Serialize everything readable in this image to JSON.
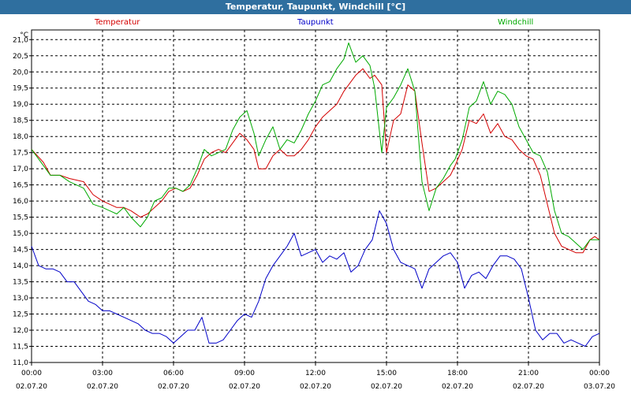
{
  "window": {
    "title": "Temperatur, Taupunkt, Windchill [°C]"
  },
  "chart_data": {
    "type": "line",
    "title": "Temperatur, Taupunkt, Windchill [°C]",
    "ylabel": "°C",
    "xlabel": "",
    "ylim": [
      11.0,
      21.3
    ],
    "xlim": [
      0,
      24
    ],
    "grid": true,
    "legend_placement": "top",
    "y_ticks": [
      "11,0",
      "11,5",
      "12,0",
      "12,5",
      "13,0",
      "13,5",
      "14,0",
      "14,5",
      "15,0",
      "15,5",
      "16,0",
      "16,5",
      "17,0",
      "17,5",
      "18,0",
      "18,5",
      "19,0",
      "19,5",
      "20,0",
      "20,5",
      "21,0"
    ],
    "x_ticks": [
      {
        "time": "00:00",
        "date": "02.07.20"
      },
      {
        "time": "03:00",
        "date": "02.07.20"
      },
      {
        "time": "06:00",
        "date": "02.07.20"
      },
      {
        "time": "09:00",
        "date": "02.07.20"
      },
      {
        "time": "12:00",
        "date": "02.07.20"
      },
      {
        "time": "15:00",
        "date": "02.07.20"
      },
      {
        "time": "18:00",
        "date": "02.07.20"
      },
      {
        "time": "21:00",
        "date": "02.07.20"
      },
      {
        "time": "00:00",
        "date": "03.07.20"
      }
    ],
    "series": [
      {
        "name": "Temperatur",
        "color": "#d40000",
        "x": [
          0,
          0.5,
          0.8,
          1.2,
          1.6,
          2.2,
          2.6,
          3.0,
          3.3,
          3.6,
          3.9,
          4.2,
          4.6,
          4.9,
          5.2,
          5.5,
          5.8,
          6.1,
          6.4,
          6.7,
          7.0,
          7.3,
          7.6,
          7.9,
          8.2,
          8.5,
          8.8,
          9.1,
          9.4,
          9.6,
          9.9,
          10.2,
          10.5,
          10.8,
          11.1,
          11.4,
          11.7,
          12.0,
          12.3,
          12.6,
          12.9,
          13.2,
          13.4,
          13.7,
          14.0,
          14.3,
          14.5,
          14.8,
          15.0,
          15.3,
          15.6,
          15.9,
          16.2,
          16.5,
          16.8,
          17.1,
          17.4,
          17.7,
          17.9,
          18.2,
          18.5,
          18.8,
          19.1,
          19.4,
          19.7,
          20.0,
          20.3,
          20.6,
          20.9,
          21.2,
          21.5,
          21.8,
          22.1,
          22.4,
          22.7,
          23.0,
          23.3,
          23.6,
          23.8,
          24.0
        ],
        "values": [
          17.6,
          17.2,
          16.8,
          16.8,
          16.7,
          16.6,
          16.2,
          16.0,
          15.9,
          15.8,
          15.8,
          15.7,
          15.5,
          15.6,
          15.8,
          16.0,
          16.3,
          16.4,
          16.3,
          16.4,
          16.8,
          17.3,
          17.5,
          17.6,
          17.5,
          17.8,
          18.1,
          17.9,
          17.6,
          17.0,
          17.0,
          17.4,
          17.6,
          17.4,
          17.4,
          17.6,
          17.9,
          18.3,
          18.6,
          18.8,
          19.0,
          19.4,
          19.6,
          19.9,
          20.1,
          19.8,
          19.9,
          19.6,
          17.5,
          18.5,
          18.7,
          19.6,
          19.4,
          17.8,
          16.3,
          16.4,
          16.6,
          16.8,
          17.1,
          17.6,
          18.5,
          18.4,
          18.7,
          18.1,
          18.4,
          18.0,
          17.9,
          17.6,
          17.4,
          17.3,
          16.8,
          15.9,
          15.0,
          14.6,
          14.5,
          14.4,
          14.4,
          14.8,
          14.9,
          14.8
        ]
      },
      {
        "name": "Taupunkt",
        "color": "#0000c8",
        "x": [
          0,
          0.3,
          0.6,
          0.9,
          1.2,
          1.5,
          1.8,
          2.1,
          2.4,
          2.7,
          3.0,
          3.3,
          3.6,
          3.9,
          4.2,
          4.5,
          4.8,
          5.1,
          5.4,
          5.7,
          6.0,
          6.3,
          6.6,
          6.9,
          7.2,
          7.5,
          7.8,
          8.1,
          8.4,
          8.7,
          9.0,
          9.3,
          9.6,
          9.9,
          10.2,
          10.5,
          10.8,
          11.1,
          11.4,
          11.7,
          12.0,
          12.3,
          12.6,
          12.9,
          13.2,
          13.5,
          13.8,
          14.1,
          14.4,
          14.7,
          15.0,
          15.3,
          15.6,
          15.9,
          16.2,
          16.5,
          16.8,
          17.1,
          17.4,
          17.7,
          18.0,
          18.3,
          18.6,
          18.9,
          19.2,
          19.5,
          19.8,
          20.1,
          20.4,
          20.7,
          21.0,
          21.3,
          21.6,
          21.9,
          22.2,
          22.5,
          22.8,
          23.1,
          23.4,
          23.7,
          24.0
        ],
        "values": [
          14.6,
          14.0,
          13.9,
          13.9,
          13.8,
          13.5,
          13.5,
          13.2,
          12.9,
          12.8,
          12.6,
          12.6,
          12.5,
          12.4,
          12.3,
          12.2,
          12.0,
          11.9,
          11.9,
          11.8,
          11.6,
          11.8,
          12.0,
          12.0,
          12.4,
          11.6,
          11.6,
          11.7,
          12.0,
          12.3,
          12.5,
          12.4,
          12.9,
          13.6,
          14.0,
          14.3,
          14.6,
          15.0,
          14.3,
          14.4,
          14.5,
          14.1,
          14.3,
          14.2,
          14.4,
          13.8,
          14.0,
          14.5,
          14.8,
          15.7,
          15.3,
          14.5,
          14.1,
          14.0,
          13.9,
          13.3,
          13.9,
          14.1,
          14.3,
          14.4,
          14.1,
          13.3,
          13.7,
          13.8,
          13.6,
          14.0,
          14.3,
          14.3,
          14.2,
          13.9,
          13.0,
          12.0,
          11.7,
          11.9,
          11.9,
          11.6,
          11.7,
          11.6,
          11.5,
          11.8,
          11.9
        ]
      },
      {
        "name": "Windchill",
        "color": "#00aa00",
        "x": [
          0,
          0.5,
          0.8,
          1.2,
          1.6,
          2.2,
          2.6,
          3.0,
          3.3,
          3.6,
          3.9,
          4.2,
          4.6,
          4.9,
          5.2,
          5.5,
          5.8,
          6.1,
          6.4,
          6.7,
          7.0,
          7.3,
          7.6,
          7.9,
          8.2,
          8.5,
          8.8,
          9.1,
          9.4,
          9.6,
          9.9,
          10.2,
          10.5,
          10.8,
          11.1,
          11.4,
          11.7,
          12.0,
          12.3,
          12.6,
          12.9,
          13.2,
          13.4,
          13.7,
          14.0,
          14.3,
          14.5,
          14.8,
          15.0,
          15.3,
          15.6,
          15.9,
          16.2,
          16.5,
          16.8,
          17.1,
          17.4,
          17.7,
          17.9,
          18.2,
          18.5,
          18.8,
          19.1,
          19.4,
          19.7,
          20.0,
          20.3,
          20.6,
          20.9,
          21.2,
          21.5,
          21.8,
          22.1,
          22.4,
          22.7,
          23.0,
          23.3,
          23.6,
          23.8,
          24.0
        ],
        "values": [
          17.6,
          17.1,
          16.8,
          16.8,
          16.6,
          16.4,
          15.9,
          15.8,
          15.7,
          15.6,
          15.8,
          15.5,
          15.2,
          15.5,
          16.0,
          16.1,
          16.4,
          16.4,
          16.3,
          16.5,
          17.0,
          17.6,
          17.4,
          17.5,
          17.6,
          18.2,
          18.6,
          18.8,
          18.1,
          17.4,
          17.9,
          18.3,
          17.6,
          17.9,
          17.8,
          18.2,
          18.7,
          19.1,
          19.6,
          19.7,
          20.1,
          20.4,
          20.9,
          20.3,
          20.5,
          20.2,
          19.5,
          17.5,
          18.9,
          19.2,
          19.6,
          20.1,
          19.4,
          16.6,
          15.7,
          16.4,
          16.7,
          17.1,
          17.3,
          17.9,
          18.9,
          19.1,
          19.7,
          19.0,
          19.4,
          19.3,
          19.0,
          18.3,
          17.9,
          17.5,
          17.4,
          16.9,
          15.7,
          15.0,
          14.9,
          14.7,
          14.5,
          14.8,
          14.8,
          14.8
        ]
      }
    ]
  }
}
